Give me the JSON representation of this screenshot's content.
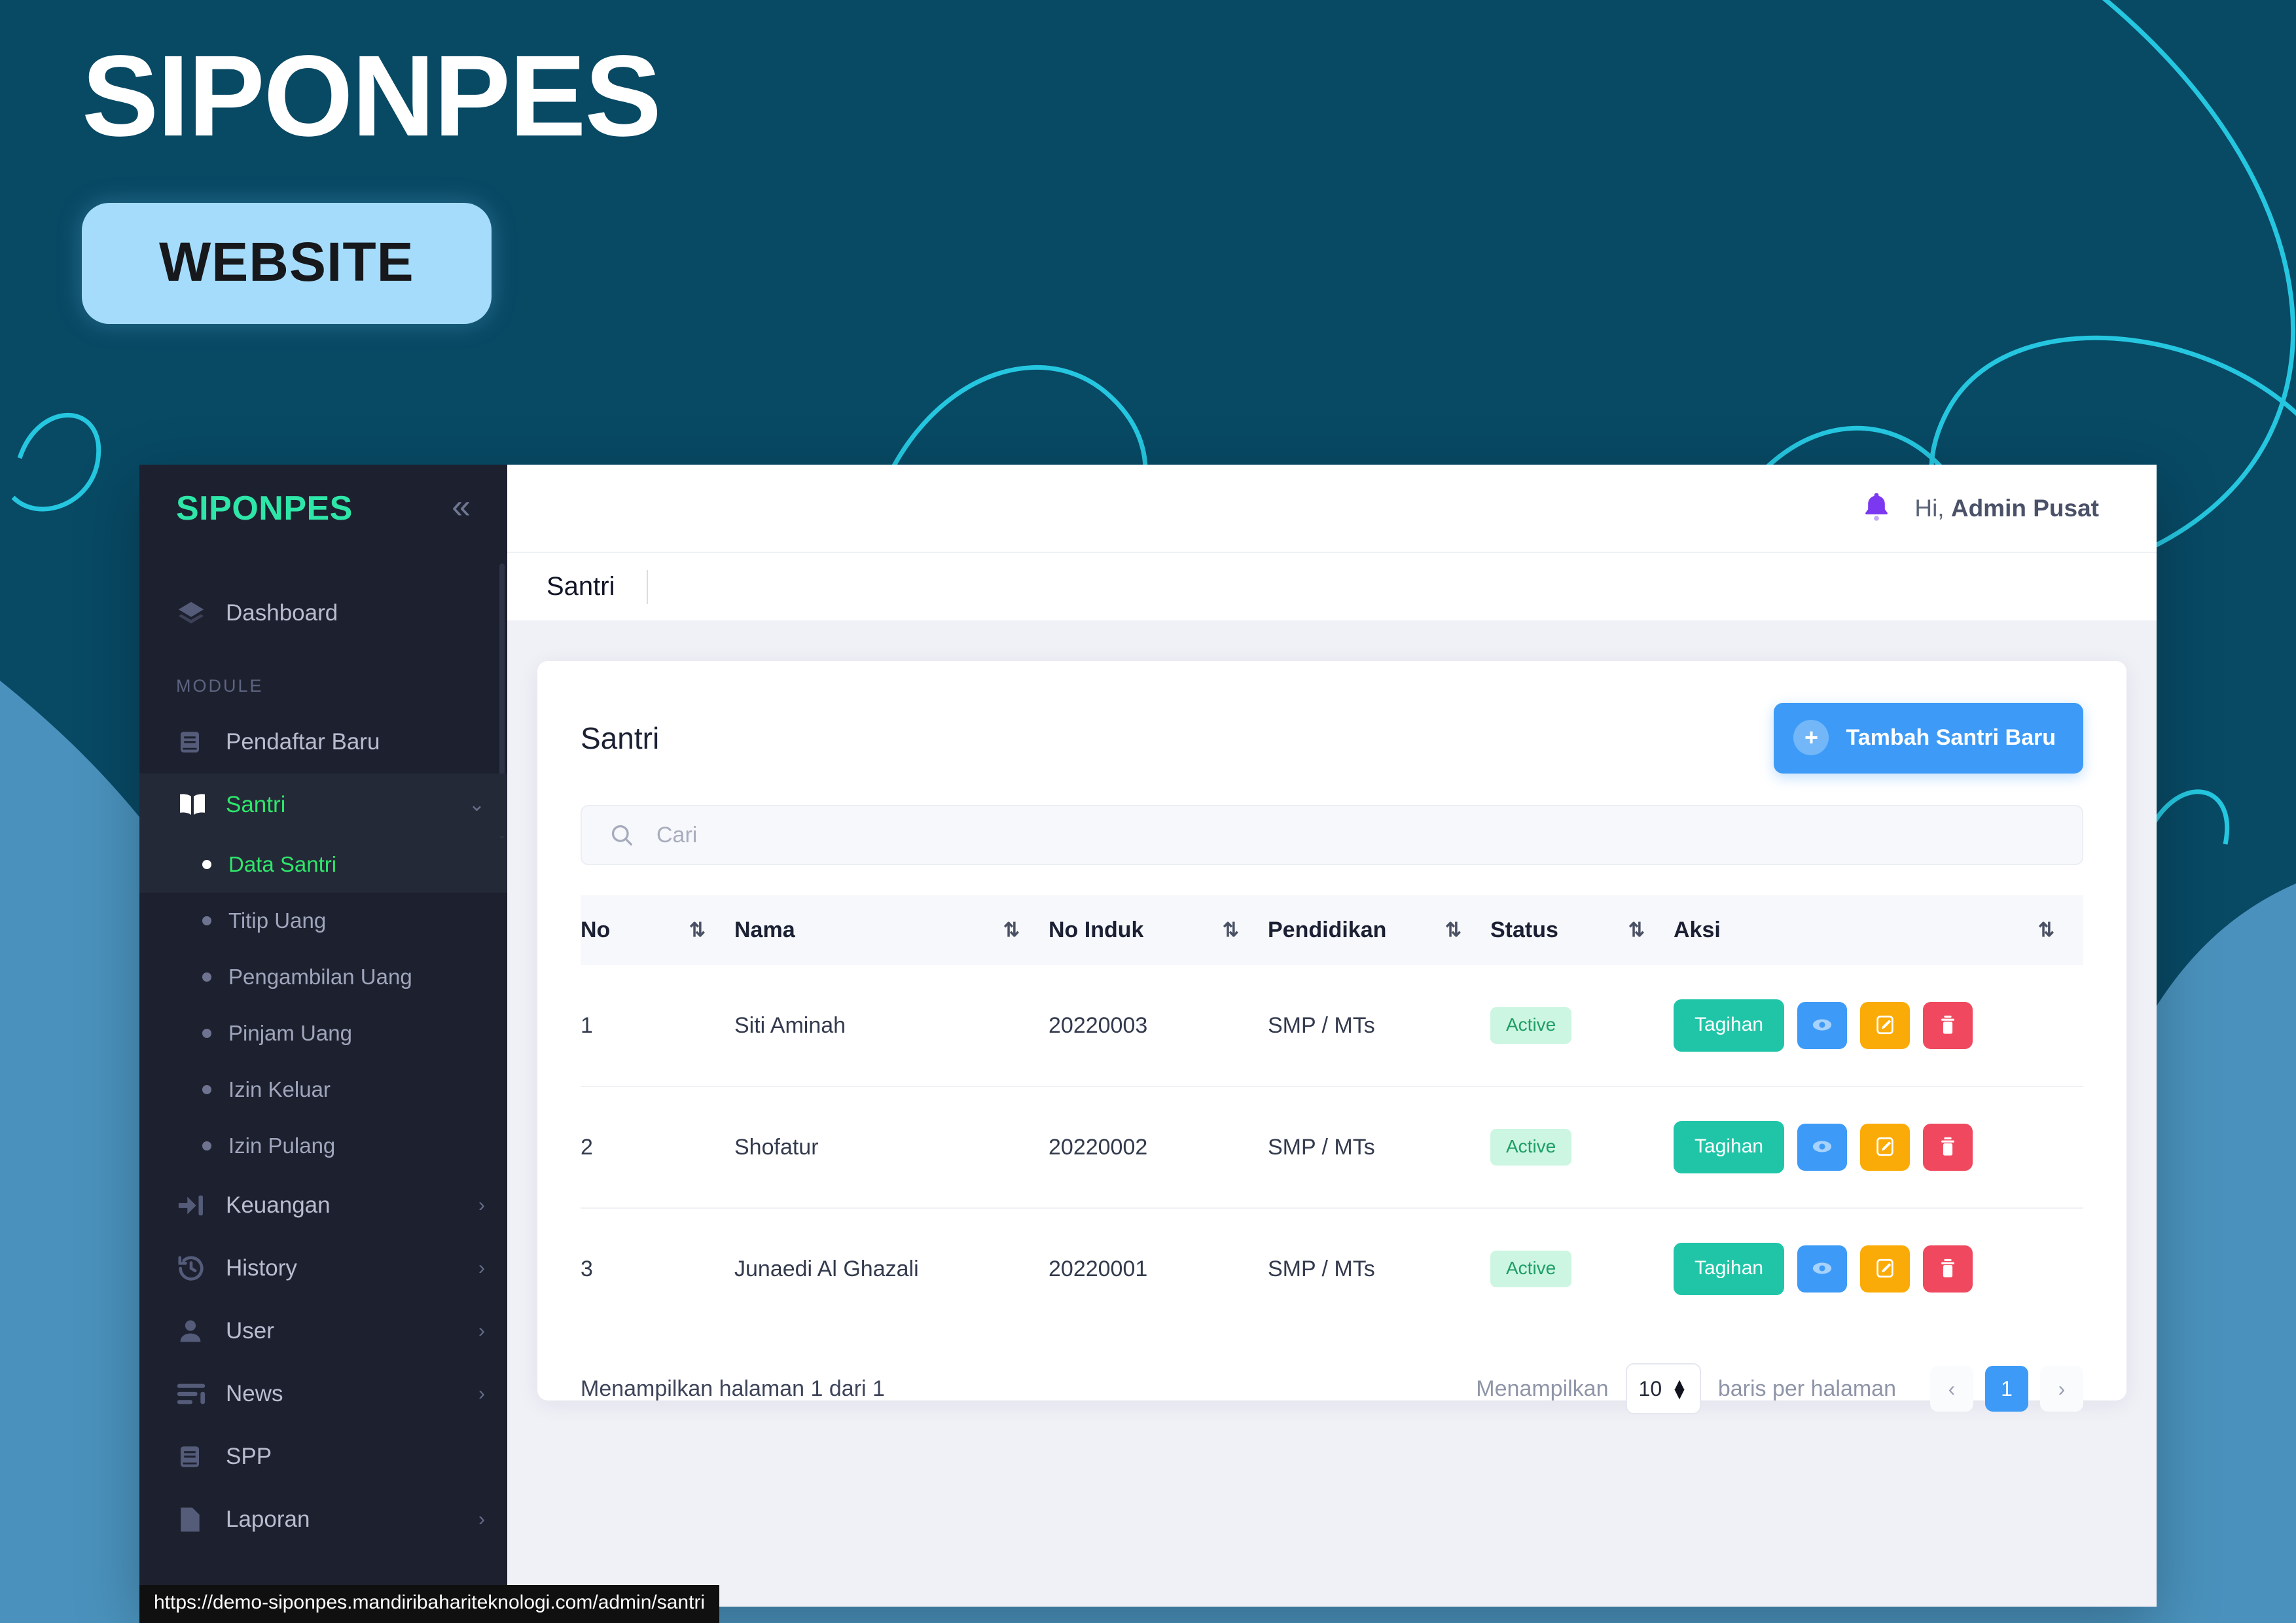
{
  "promo": {
    "title": "SIPONPES",
    "badge": "WEBSITE"
  },
  "statusbar": {
    "url": "https://demo-siponpes.mandiribahariteknologi.com/admin/santri"
  },
  "sidebar": {
    "brand": "SIPONPES",
    "collapse_icon": "chevron-double-left-icon",
    "dashboard": {
      "label": "Dashboard",
      "icon": "layers-icon"
    },
    "section_label": "MODULE",
    "items": [
      {
        "label": "Pendaftar Baru",
        "icon": "book-icon",
        "caret": ""
      },
      {
        "label": "Santri",
        "icon": "open-book-icon",
        "caret": "⌄",
        "active": true
      },
      {
        "label": "Keuangan",
        "icon": "login-arrow-icon",
        "caret": "›"
      },
      {
        "label": "History",
        "icon": "history-icon",
        "caret": "›"
      },
      {
        "label": "User",
        "icon": "person-icon",
        "caret": "›"
      },
      {
        "label": "News",
        "icon": "list-icon",
        "caret": "›"
      },
      {
        "label": "SPP",
        "icon": "book-icon",
        "caret": ""
      },
      {
        "label": "Laporan",
        "icon": "document-icon",
        "caret": "›"
      }
    ],
    "subitems": [
      {
        "label": "Data Santri",
        "active": true
      },
      {
        "label": "Titip Uang",
        "active": false
      },
      {
        "label": "Pengambilan Uang",
        "active": false
      },
      {
        "label": "Pinjam Uang",
        "active": false
      },
      {
        "label": "Izin Keluar",
        "active": false
      },
      {
        "label": "Izin Pulang",
        "active": false
      }
    ]
  },
  "topbar": {
    "bell_icon": "bell-icon",
    "greeting_prefix": "Hi, ",
    "user_name": "Admin Pusat"
  },
  "breadcrumb": {
    "current": "Santri"
  },
  "card": {
    "title": "Santri",
    "add_button": "Tambah Santri Baru",
    "add_icon": "plus-icon"
  },
  "search": {
    "placeholder": "Cari",
    "value": "",
    "icon": "search-icon"
  },
  "table": {
    "columns": [
      "No",
      "Nama",
      "No Induk",
      "Pendidikan",
      "Status",
      "Aksi"
    ],
    "sort_icon": "sort-updown-icon",
    "rows": [
      {
        "no": "1",
        "nama": "Siti Aminah",
        "no_induk": "20220003",
        "pendidikan": "SMP / MTs",
        "status": "Active",
        "aksi": {
          "tagihan": "Tagihan",
          "view_icon": "eye-icon",
          "edit_icon": "pencil-icon",
          "delete_icon": "trash-icon"
        }
      },
      {
        "no": "2",
        "nama": "Shofatur",
        "no_induk": "20220002",
        "pendidikan": "SMP / MTs",
        "status": "Active",
        "aksi": {
          "tagihan": "Tagihan",
          "view_icon": "eye-icon",
          "edit_icon": "pencil-icon",
          "delete_icon": "trash-icon"
        }
      },
      {
        "no": "3",
        "nama": "Junaedi Al Ghazali",
        "no_induk": "20220001",
        "pendidikan": "SMP / MTs",
        "status": "Active",
        "aksi": {
          "tagihan": "Tagihan",
          "view_icon": "eye-icon",
          "edit_icon": "pencil-icon",
          "delete_icon": "trash-icon"
        }
      }
    ]
  },
  "footer": {
    "showing_text": "Menampilkan halaman 1 dari 1",
    "perpage_prefix": "Menampilkan",
    "perpage_value": "10",
    "perpage_suffix": "baris per halaman",
    "prev": "‹",
    "current_page": "1",
    "next": "›"
  },
  "colors": {
    "background_dark": "#084964",
    "background_blue": "#4a92bd",
    "accent_cyan": "#25c7e0",
    "brand_green": "#2ee6a8",
    "sidebar": "#1d212f",
    "primary_blue": "#3d9bf7",
    "teal": "#20c5a8",
    "amber": "#fbab07",
    "red": "#f0495f",
    "badge_bg": "#cdf6e2",
    "badge_text": "#1e9e66"
  }
}
